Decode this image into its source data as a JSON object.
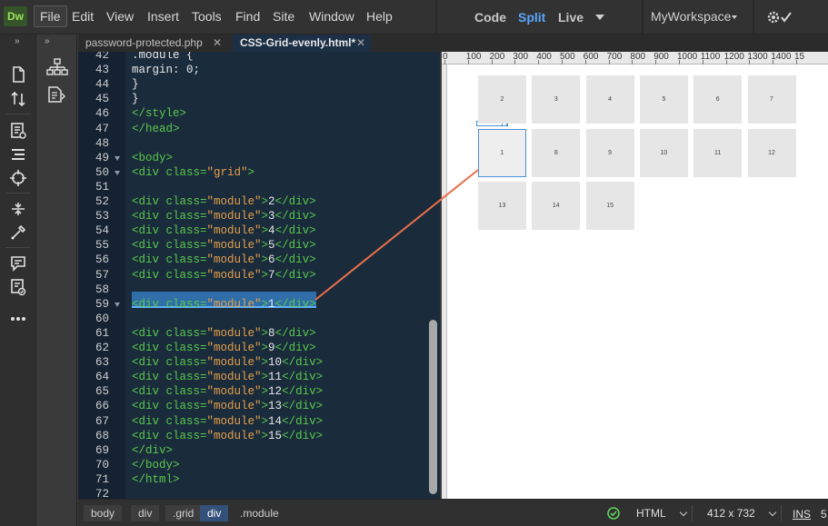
{
  "app": {
    "logo": "Dw"
  },
  "menu": [
    "File",
    "Edit",
    "View",
    "Insert",
    "Tools",
    "Find",
    "Site",
    "Window",
    "Help"
  ],
  "menu_active": "File",
  "view_modes": [
    "Code",
    "Split",
    "Live"
  ],
  "view_active": "Split",
  "workspace": "MyWorkspace",
  "tabs": [
    {
      "label": "password-protected.php",
      "active": false
    },
    {
      "label": "CSS-Grid-evenly.html*",
      "active": true
    }
  ],
  "left_toolbar": {
    "collapse": "»",
    "icons": [
      "new-file-icon",
      "sort-icon",
      "snippet-icon",
      "align-icon",
      "target-icon",
      "expand-icon",
      "eyedropper-icon",
      "comment-icon",
      "validate-icon",
      "more-icon"
    ]
  },
  "panel_strip": {
    "collapse": "»",
    "icons": [
      "dom-tree-icon",
      "code-navigator-icon"
    ]
  },
  "code": {
    "highlighted_line": 59,
    "lines": [
      {
        "n": 42,
        "fold": false,
        "segments": [
          {
            "t": ".module {",
            "c": "css"
          }
        ]
      },
      {
        "n": 43,
        "fold": false,
        "segments": [
          {
            "t": "margin: 0;",
            "c": "css"
          }
        ]
      },
      {
        "n": 44,
        "fold": false,
        "segments": [
          {
            "t": "}",
            "c": "css"
          }
        ]
      },
      {
        "n": 45,
        "fold": false,
        "segments": [
          {
            "t": "}",
            "c": "css"
          }
        ]
      },
      {
        "n": 46,
        "fold": false,
        "segments": [
          {
            "t": "</style>",
            "c": "tag"
          }
        ]
      },
      {
        "n": 47,
        "fold": false,
        "segments": [
          {
            "t": "</head>",
            "c": "tag"
          }
        ]
      },
      {
        "n": 48,
        "fold": false,
        "segments": []
      },
      {
        "n": 49,
        "fold": true,
        "segments": [
          {
            "t": "<body>",
            "c": "tag"
          }
        ]
      },
      {
        "n": 50,
        "fold": true,
        "segments": [
          {
            "t": "<div class=",
            "c": "tag"
          },
          {
            "t": "\"grid\"",
            "c": "str"
          },
          {
            "t": ">",
            "c": "tag"
          }
        ]
      },
      {
        "n": 51,
        "fold": false,
        "segments": []
      },
      {
        "n": 52,
        "fold": false,
        "segments": [
          {
            "t": "<div class=",
            "c": "tag"
          },
          {
            "t": "\"module\"",
            "c": "str"
          },
          {
            "t": ">",
            "c": "tag"
          },
          {
            "t": "2",
            "c": "txt"
          },
          {
            "t": "</div>",
            "c": "tag"
          }
        ]
      },
      {
        "n": 53,
        "fold": false,
        "segments": [
          {
            "t": "<div class=",
            "c": "tag"
          },
          {
            "t": "\"module\"",
            "c": "str"
          },
          {
            "t": ">",
            "c": "tag"
          },
          {
            "t": "3",
            "c": "txt"
          },
          {
            "t": "</div>",
            "c": "tag"
          }
        ]
      },
      {
        "n": 54,
        "fold": false,
        "segments": [
          {
            "t": "<div class=",
            "c": "tag"
          },
          {
            "t": "\"module\"",
            "c": "str"
          },
          {
            "t": ">",
            "c": "tag"
          },
          {
            "t": "4",
            "c": "txt"
          },
          {
            "t": "</div>",
            "c": "tag"
          }
        ]
      },
      {
        "n": 55,
        "fold": false,
        "segments": [
          {
            "t": "<div class=",
            "c": "tag"
          },
          {
            "t": "\"module\"",
            "c": "str"
          },
          {
            "t": ">",
            "c": "tag"
          },
          {
            "t": "5",
            "c": "txt"
          },
          {
            "t": "</div>",
            "c": "tag"
          }
        ]
      },
      {
        "n": 56,
        "fold": false,
        "segments": [
          {
            "t": "<div class=",
            "c": "tag"
          },
          {
            "t": "\"module\"",
            "c": "str"
          },
          {
            "t": ">",
            "c": "tag"
          },
          {
            "t": "6",
            "c": "txt"
          },
          {
            "t": "</div>",
            "c": "tag"
          }
        ]
      },
      {
        "n": 57,
        "fold": false,
        "segments": [
          {
            "t": "<div class=",
            "c": "tag"
          },
          {
            "t": "\"module\"",
            "c": "str"
          },
          {
            "t": ">",
            "c": "tag"
          },
          {
            "t": "7",
            "c": "txt"
          },
          {
            "t": "</div>",
            "c": "tag"
          }
        ]
      },
      {
        "n": 58,
        "fold": false,
        "segments": []
      },
      {
        "n": 59,
        "fold": true,
        "segments": [
          {
            "t": "<div class=",
            "c": "tag"
          },
          {
            "t": "\"module\"",
            "c": "str"
          },
          {
            "t": ">",
            "c": "tag"
          },
          {
            "t": "1",
            "c": "txt"
          },
          {
            "t": "</div>",
            "c": "tag"
          }
        ]
      },
      {
        "n": 60,
        "fold": false,
        "segments": []
      },
      {
        "n": 61,
        "fold": false,
        "segments": [
          {
            "t": "<div class=",
            "c": "tag"
          },
          {
            "t": "\"module\"",
            "c": "str"
          },
          {
            "t": ">",
            "c": "tag"
          },
          {
            "t": "8",
            "c": "txt"
          },
          {
            "t": "</div>",
            "c": "tag"
          }
        ]
      },
      {
        "n": 62,
        "fold": false,
        "segments": [
          {
            "t": "<div class=",
            "c": "tag"
          },
          {
            "t": "\"module\"",
            "c": "str"
          },
          {
            "t": ">",
            "c": "tag"
          },
          {
            "t": "9",
            "c": "txt"
          },
          {
            "t": "</div>",
            "c": "tag"
          }
        ]
      },
      {
        "n": 63,
        "fold": false,
        "segments": [
          {
            "t": "<div class=",
            "c": "tag"
          },
          {
            "t": "\"module\"",
            "c": "str"
          },
          {
            "t": ">",
            "c": "tag"
          },
          {
            "t": "10",
            "c": "txt"
          },
          {
            "t": "</div>",
            "c": "tag"
          }
        ]
      },
      {
        "n": 64,
        "fold": false,
        "segments": [
          {
            "t": "<div class=",
            "c": "tag"
          },
          {
            "t": "\"module\"",
            "c": "str"
          },
          {
            "t": ">",
            "c": "tag"
          },
          {
            "t": "11",
            "c": "txt"
          },
          {
            "t": "</div>",
            "c": "tag"
          }
        ]
      },
      {
        "n": 65,
        "fold": false,
        "segments": [
          {
            "t": "<div class=",
            "c": "tag"
          },
          {
            "t": "\"module\"",
            "c": "str"
          },
          {
            "t": ">",
            "c": "tag"
          },
          {
            "t": "12",
            "c": "txt"
          },
          {
            "t": "</div>",
            "c": "tag"
          }
        ]
      },
      {
        "n": 66,
        "fold": false,
        "segments": [
          {
            "t": "<div class=",
            "c": "tag"
          },
          {
            "t": "\"module\"",
            "c": "str"
          },
          {
            "t": ">",
            "c": "tag"
          },
          {
            "t": "13",
            "c": "txt"
          },
          {
            "t": "</div>",
            "c": "tag"
          }
        ]
      },
      {
        "n": 67,
        "fold": false,
        "segments": [
          {
            "t": "<div class=",
            "c": "tag"
          },
          {
            "t": "\"module\"",
            "c": "str"
          },
          {
            "t": ">",
            "c": "tag"
          },
          {
            "t": "14",
            "c": "txt"
          },
          {
            "t": "</div>",
            "c": "tag"
          }
        ]
      },
      {
        "n": 68,
        "fold": false,
        "segments": [
          {
            "t": "<div class=",
            "c": "tag"
          },
          {
            "t": "\"module\"",
            "c": "str"
          },
          {
            "t": ">",
            "c": "tag"
          },
          {
            "t": "15",
            "c": "txt"
          },
          {
            "t": "</div>",
            "c": "tag"
          }
        ]
      },
      {
        "n": 69,
        "fold": false,
        "segments": [
          {
            "t": "</div>",
            "c": "tag"
          }
        ]
      },
      {
        "n": 70,
        "fold": false,
        "segments": [
          {
            "t": "</body>",
            "c": "tag"
          }
        ]
      },
      {
        "n": 71,
        "fold": false,
        "segments": [
          {
            "t": "</html>",
            "c": "tag"
          }
        ]
      },
      {
        "n": 72,
        "fold": false,
        "segments": []
      }
    ]
  },
  "ruler": {
    "labels": [
      "0",
      "100",
      "200",
      "300",
      "400",
      "500",
      "600",
      "700",
      "800",
      "900",
      "1000",
      "1100",
      "1200",
      "1300",
      "1400",
      "15"
    ]
  },
  "live_modules": {
    "rows": [
      [
        "2",
        "3",
        "4",
        "5",
        "6",
        "7"
      ],
      [
        "1",
        "8",
        "9",
        "10",
        "11",
        "12"
      ],
      [
        "13",
        "14",
        "15"
      ]
    ],
    "selected": "1"
  },
  "status": {
    "breadcrumb": [
      "body",
      "div",
      ".grid",
      "div",
      ".module"
    ],
    "breadcrumb_active": 3,
    "doc_type": "HTML",
    "screen_size": "412 x 732",
    "ins": "INS",
    "ins_extra": "5"
  },
  "colors": {
    "accent": "#5aa6ff",
    "tag": "#59c94b",
    "string": "#e5a04a",
    "callout_line": "#e8704a",
    "selection": "#2f6ea8"
  }
}
